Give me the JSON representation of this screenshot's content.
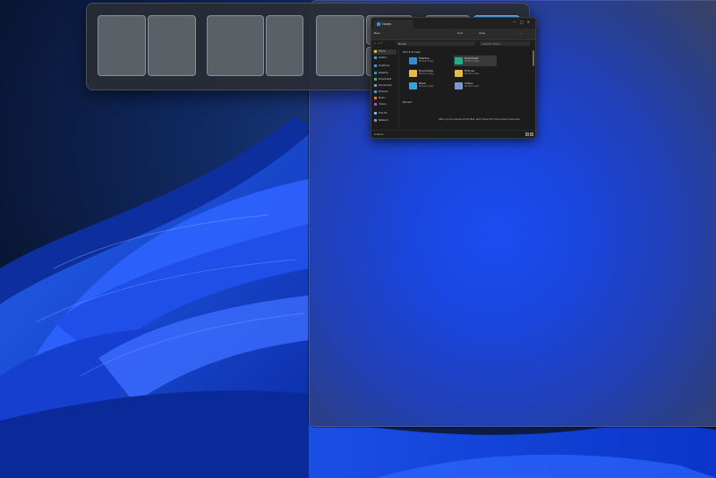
{
  "colors": {
    "accent": "#4aa0e6",
    "zone": "#5b5f66",
    "folder": "#e8b84a",
    "gallery": "#3aa0d8",
    "desktop": "#2f8fd6",
    "explorer_bg": "#1c1c1c"
  },
  "explorer": {
    "tab_title": "Home",
    "toolbar": {
      "new_label": "New",
      "sort_label": "Sort",
      "view_label": "View",
      "more_label": "..."
    },
    "address": {
      "path": "Home",
      "search_placeholder": "Search Home"
    },
    "sidebar": {
      "items": [
        {
          "label": "Home",
          "icon": "home-icon"
        },
        {
          "label": "Gallery",
          "icon": "gallery-icon"
        },
        {
          "label": "OneDrive",
          "icon": "cloud-icon"
        },
        {
          "label": "Desktop",
          "icon": "desktop-icon"
        },
        {
          "label": "Downloads",
          "icon": "download-icon"
        },
        {
          "label": "Documents",
          "icon": "documents-icon"
        },
        {
          "label": "Pictures",
          "icon": "pictures-icon"
        },
        {
          "label": "Music",
          "icon": "music-icon"
        },
        {
          "label": "Videos",
          "icon": "videos-icon"
        },
        {
          "label": "This PC",
          "icon": "pc-icon"
        },
        {
          "label": "Network",
          "icon": "network-icon"
        }
      ]
    },
    "quick_access": {
      "heading": "Quick access",
      "items": [
        {
          "name": "Desktop",
          "sub": "Stored locally",
          "icon": "desktop-folder-icon"
        },
        {
          "name": "Downloads",
          "sub": "Stored locally",
          "icon": "downloads-folder-icon"
        },
        {
          "name": "Documents",
          "sub": "Stored locally",
          "icon": "documents-folder-icon"
        },
        {
          "name": "Pictures",
          "sub": "Stored locally",
          "icon": "pictures-folder-icon"
        },
        {
          "name": "Music",
          "sub": "Stored locally",
          "icon": "music-folder-icon"
        },
        {
          "name": "Videos",
          "sub": "Stored locally",
          "icon": "videos-folder-icon"
        }
      ]
    },
    "recent": {
      "heading": "Recent",
      "empty_message": "After you've opened some files, we'll show the most recent ones here."
    },
    "status": "6 items"
  }
}
